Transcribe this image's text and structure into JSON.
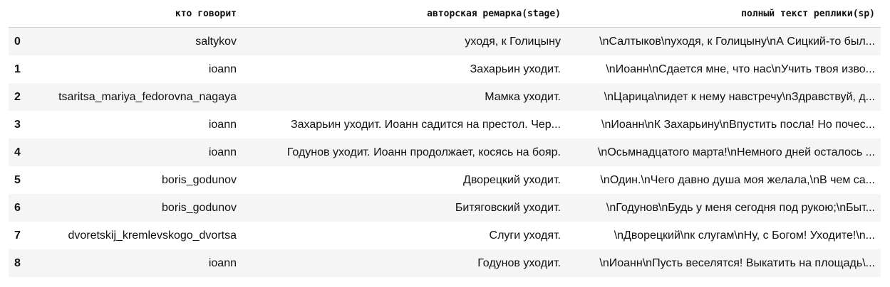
{
  "table": {
    "columns": [
      "",
      "кто говорит",
      "авторская ремарка(stage)",
      "полный текст реплики(sp)"
    ],
    "rows": [
      {
        "index": "0",
        "speaker": "saltykov",
        "stage": "уходя, к Голицыну",
        "text": "\\nСалтыков\\nуходя, к Голицыну\\nА Сицкий-то был..."
      },
      {
        "index": "1",
        "speaker": "ioann",
        "stage": "Захарьин уходит.",
        "text": "\\nИоанн\\nСдается мне, что нас\\nУчить твоя изво..."
      },
      {
        "index": "2",
        "speaker": "tsaritsa_mariya_fedorovna_nagaya",
        "stage": "Мамка уходит.",
        "text": "\\nЦарица\\nидет к нему навстречу\\nЗдравствуй, д..."
      },
      {
        "index": "3",
        "speaker": "ioann",
        "stage": "Захарьин уходит. Иоанн садится на престол. Чер...",
        "text": "\\nИоанн\\nК Захарьину\\nВпустить посла! Но почес..."
      },
      {
        "index": "4",
        "speaker": "ioann",
        "stage": "Годунов уходит. Иоанн продолжает, косясь на бояр.",
        "text": "\\nОсьмнадцатого марта!\\nНемного дней осталось ..."
      },
      {
        "index": "5",
        "speaker": "boris_godunov",
        "stage": "Дворецкий уходит.",
        "text": "\\nОдин.\\nЧего давно душа моя желала,\\nВ чем са..."
      },
      {
        "index": "6",
        "speaker": "boris_godunov",
        "stage": "Битяговский уходит.",
        "text": "\\nГодунов\\nБудь у меня сегодня под рукою;\\nБыт..."
      },
      {
        "index": "7",
        "speaker": "dvoretskij_kremlevskogo_dvortsa",
        "stage": "Слуги уходят.",
        "text": "\\nДворецкий\\nк слугам\\nНу, с Богом! Уходите!\\n..."
      },
      {
        "index": "8",
        "speaker": "ioann",
        "stage": "Годунов уходит.",
        "text": "\\nИоанн\\nПусть веселятся! Выкатить на площадь\\..."
      }
    ]
  }
}
